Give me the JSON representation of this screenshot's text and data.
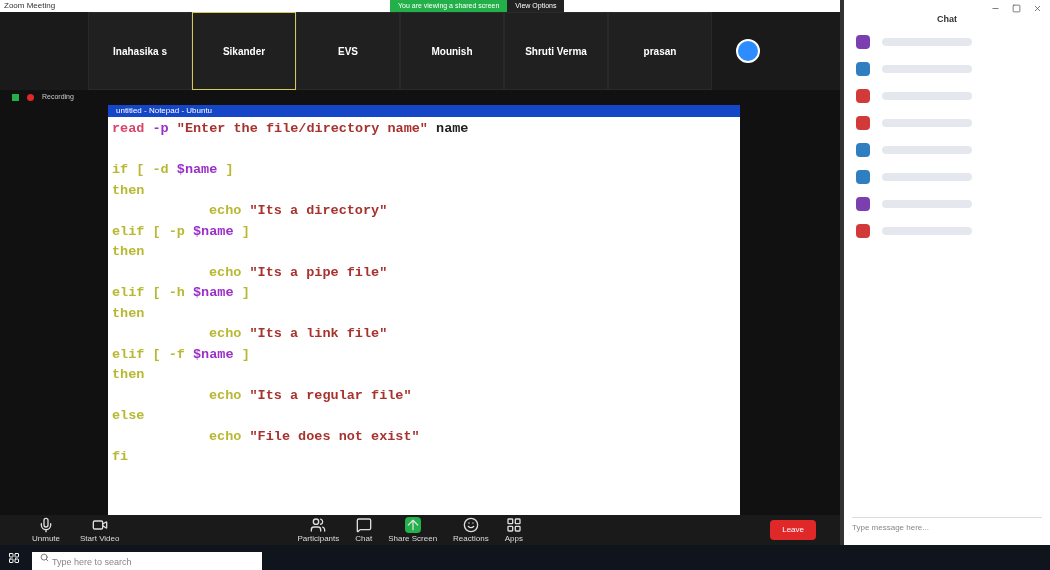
{
  "window": {
    "title": "Zoom Meeting"
  },
  "banner": {
    "label": "You are viewing a shared screen",
    "button": "View Options"
  },
  "participants": [
    {
      "name": "Inahasika s",
      "selected": false
    },
    {
      "name": "Sikander",
      "selected": true
    },
    {
      "name": "EVS",
      "selected": false
    },
    {
      "name": "Mounish",
      "selected": false
    },
    {
      "name": "Shruti Verma",
      "selected": false
    },
    {
      "name": "prasan",
      "selected": false
    }
  ],
  "recording": {
    "label": "Recording"
  },
  "editor": {
    "title": "untitled - Notepad - Ubuntu",
    "lines": [
      {
        "kind": "code",
        "indented": false,
        "tokens": [
          {
            "kind": "command",
            "text": "read"
          },
          {
            "kind": "option",
            "text": " -p "
          },
          {
            "kind": "string",
            "text": "\"Enter the file/directory name\""
          },
          {
            "kind": "plain",
            "text": " name"
          }
        ]
      },
      {
        "kind": "blank"
      },
      {
        "kind": "code",
        "indented": false,
        "tokens": [
          {
            "kind": "keyword",
            "text": "if [ -d "
          },
          {
            "kind": "variable",
            "text": "$name"
          },
          {
            "kind": "keyword",
            "text": " ]"
          }
        ]
      },
      {
        "kind": "code",
        "indented": false,
        "tokens": [
          {
            "kind": "keyword",
            "text": "then"
          }
        ]
      },
      {
        "kind": "code",
        "indented": true,
        "tokens": [
          {
            "kind": "keyword",
            "text": "echo "
          },
          {
            "kind": "string",
            "text": "\"Its a directory\""
          }
        ]
      },
      {
        "kind": "code",
        "indented": false,
        "tokens": [
          {
            "kind": "keyword",
            "text": "elif [ -p "
          },
          {
            "kind": "variable",
            "text": "$name"
          },
          {
            "kind": "keyword",
            "text": " ]"
          }
        ]
      },
      {
        "kind": "code",
        "indented": false,
        "tokens": [
          {
            "kind": "keyword",
            "text": "then"
          }
        ]
      },
      {
        "kind": "code",
        "indented": true,
        "tokens": [
          {
            "kind": "keyword",
            "text": "echo "
          },
          {
            "kind": "string",
            "text": "\"Its a pipe file\""
          }
        ]
      },
      {
        "kind": "code",
        "indented": false,
        "tokens": [
          {
            "kind": "keyword",
            "text": "elif [ -h "
          },
          {
            "kind": "variable",
            "text": "$name"
          },
          {
            "kind": "keyword",
            "text": " ]"
          }
        ]
      },
      {
        "kind": "code",
        "indented": false,
        "tokens": [
          {
            "kind": "keyword",
            "text": "then"
          }
        ]
      },
      {
        "kind": "code",
        "indented": true,
        "tokens": [
          {
            "kind": "keyword",
            "text": "echo "
          },
          {
            "kind": "string",
            "text": "\"Its a link file\""
          }
        ]
      },
      {
        "kind": "code",
        "indented": false,
        "tokens": [
          {
            "kind": "keyword",
            "text": "elif [ -f "
          },
          {
            "kind": "variable",
            "text": "$name"
          },
          {
            "kind": "keyword",
            "text": " ]"
          }
        ]
      },
      {
        "kind": "code",
        "indented": false,
        "tokens": [
          {
            "kind": "keyword",
            "text": "then"
          }
        ]
      },
      {
        "kind": "code",
        "indented": true,
        "tokens": [
          {
            "kind": "keyword",
            "text": "echo "
          },
          {
            "kind": "string",
            "text": "\"Its a regular file\""
          }
        ]
      },
      {
        "kind": "code",
        "indented": false,
        "tokens": [
          {
            "kind": "keyword",
            "text": "else"
          }
        ]
      },
      {
        "kind": "code",
        "indented": true,
        "tokens": [
          {
            "kind": "keyword",
            "text": "echo "
          },
          {
            "kind": "string",
            "text": "\"File does not exist\""
          }
        ]
      },
      {
        "kind": "code",
        "indented": false,
        "tokens": [
          {
            "kind": "keyword",
            "text": "fi"
          }
        ]
      }
    ]
  },
  "toolbar": [
    {
      "label": "Unmute",
      "kind": "mic"
    },
    {
      "label": "Start Video",
      "kind": "video"
    },
    {
      "label": "Participants",
      "kind": "people"
    },
    {
      "label": "Chat",
      "kind": "chat"
    },
    {
      "label": "Share Screen",
      "kind": "share"
    },
    {
      "label": "Reactions",
      "kind": "smile"
    },
    {
      "label": "Apps",
      "kind": "apps"
    }
  ],
  "leave_button": "Leave",
  "chat": {
    "title": "Chat",
    "messages": [
      {
        "color": "#7b3fb0"
      },
      {
        "color": "#2f7fc0"
      },
      {
        "color": "#d23a3a"
      },
      {
        "color": "#d23a3a"
      },
      {
        "color": "#2f7fc0"
      },
      {
        "color": "#2f7fc0"
      },
      {
        "color": "#7b3fb0"
      },
      {
        "color": "#d23a3a"
      }
    ],
    "input_placeholder": "Type message here..."
  },
  "taskbar": {
    "search_placeholder": "Type here to search"
  }
}
